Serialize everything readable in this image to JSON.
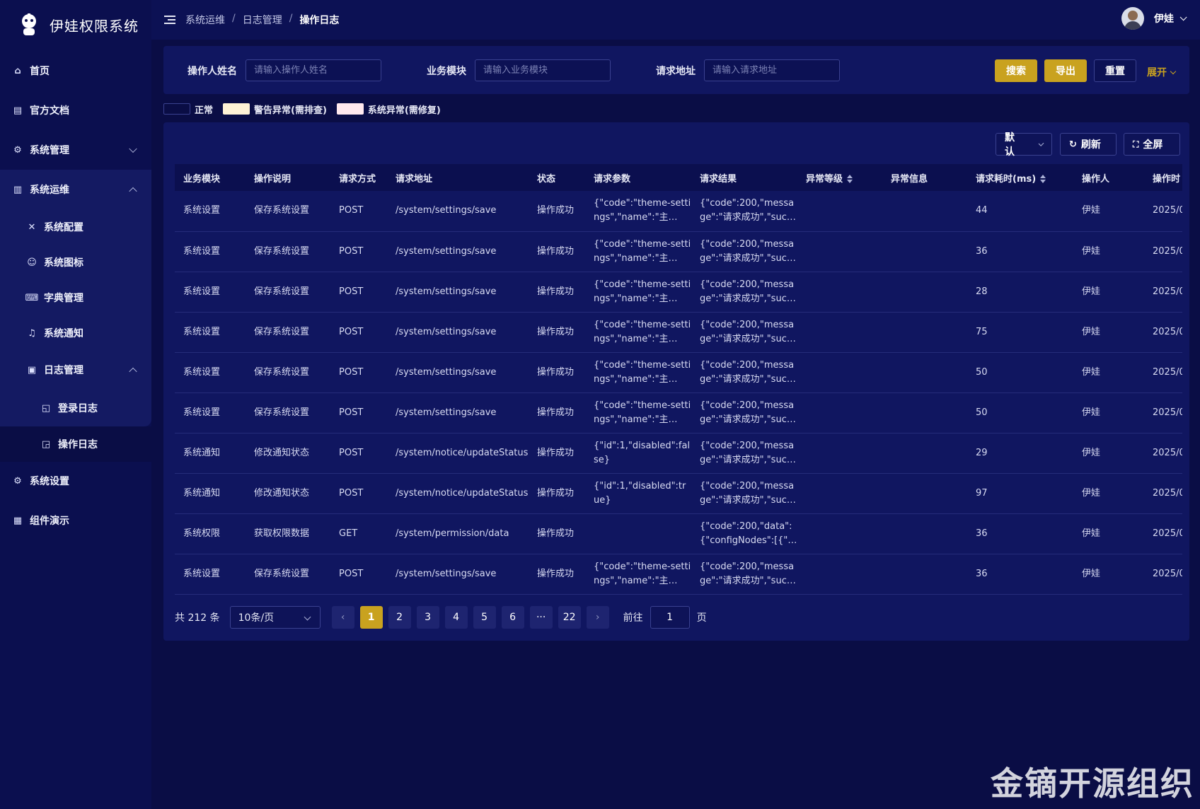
{
  "app": {
    "title": "伊娃权限系统"
  },
  "sidebar": {
    "items": [
      {
        "label": "首页",
        "icon": "home-icon"
      },
      {
        "label": "官方文档",
        "icon": "doc-icon"
      },
      {
        "label": "系统管理",
        "icon": "gear-icon"
      },
      {
        "label": "系统运维",
        "icon": "bar-chart-icon"
      },
      {
        "label": "系统配置",
        "icon": "tools-icon"
      },
      {
        "label": "系统图标",
        "icon": "smile-icon"
      },
      {
        "label": "字典管理",
        "icon": "keyboard-icon"
      },
      {
        "label": "系统通知",
        "icon": "bell-icon"
      },
      {
        "label": "日志管理",
        "icon": "clipboard-icon"
      },
      {
        "label": "登录日志",
        "icon": "login-log-icon"
      },
      {
        "label": "操作日志",
        "icon": "operation-log-icon"
      },
      {
        "label": "系统设置",
        "icon": "gear-icon"
      },
      {
        "label": "组件演示",
        "icon": "component-icon"
      }
    ]
  },
  "header": {
    "breadcrumb": [
      "系统运维",
      "日志管理",
      "操作日志"
    ],
    "separator": "/",
    "user": "伊娃"
  },
  "filter": {
    "operator_label": "操作人姓名",
    "operator_placeholder": "请输入操作人姓名",
    "module_label": "业务模块",
    "module_placeholder": "请输入业务模块",
    "url_label": "请求地址",
    "url_placeholder": "请输入请求地址",
    "search": "搜索",
    "export": "导出",
    "reset": "重置",
    "expand": "展开"
  },
  "legend": {
    "items": [
      {
        "label": "正常",
        "color": "#0a0d45"
      },
      {
        "label": "警告异常(需排查)",
        "color": "#fff3d6"
      },
      {
        "label": "系统异常(需修复)",
        "color": "#ffe9ee"
      }
    ]
  },
  "toolbar": {
    "size": "默认",
    "refresh": "刷新",
    "fullscreen": "全屏"
  },
  "table": {
    "columns": [
      "业务模块",
      "操作说明",
      "请求方式",
      "请求地址",
      "状态",
      "请求参数",
      "请求结果",
      "异常等级",
      "异常信息",
      "请求耗时(ms)",
      "操作人",
      "操作时"
    ],
    "rows": [
      [
        "系统设置",
        "保存系统设置",
        "POST",
        "/system/settings/save",
        "操作成功",
        "{\"code\":\"theme-settings\",\"name\":\"主…",
        "{\"code\":200,\"message\":\"请求成功\",\"suc…",
        "",
        "",
        "44",
        "伊娃",
        "2025/0"
      ],
      [
        "系统设置",
        "保存系统设置",
        "POST",
        "/system/settings/save",
        "操作成功",
        "{\"code\":\"theme-settings\",\"name\":\"主…",
        "{\"code\":200,\"message\":\"请求成功\",\"suc…",
        "",
        "",
        "36",
        "伊娃",
        "2025/0"
      ],
      [
        "系统设置",
        "保存系统设置",
        "POST",
        "/system/settings/save",
        "操作成功",
        "{\"code\":\"theme-settings\",\"name\":\"主…",
        "{\"code\":200,\"message\":\"请求成功\",\"suc…",
        "",
        "",
        "28",
        "伊娃",
        "2025/0"
      ],
      [
        "系统设置",
        "保存系统设置",
        "POST",
        "/system/settings/save",
        "操作成功",
        "{\"code\":\"theme-settings\",\"name\":\"主…",
        "{\"code\":200,\"message\":\"请求成功\",\"suc…",
        "",
        "",
        "75",
        "伊娃",
        "2025/0"
      ],
      [
        "系统设置",
        "保存系统设置",
        "POST",
        "/system/settings/save",
        "操作成功",
        "{\"code\":\"theme-settings\",\"name\":\"主…",
        "{\"code\":200,\"message\":\"请求成功\",\"suc…",
        "",
        "",
        "50",
        "伊娃",
        "2025/0"
      ],
      [
        "系统设置",
        "保存系统设置",
        "POST",
        "/system/settings/save",
        "操作成功",
        "{\"code\":\"theme-settings\",\"name\":\"主…",
        "{\"code\":200,\"message\":\"请求成功\",\"suc…",
        "",
        "",
        "50",
        "伊娃",
        "2025/0"
      ],
      [
        "系统通知",
        "修改通知状态",
        "POST",
        "/system/notice/updateStatus",
        "操作成功",
        "{\"id\":1,\"disabled\":false}",
        "{\"code\":200,\"message\":\"请求成功\",\"suc…",
        "",
        "",
        "29",
        "伊娃",
        "2025/0"
      ],
      [
        "系统通知",
        "修改通知状态",
        "POST",
        "/system/notice/updateStatus",
        "操作成功",
        "{\"id\":1,\"disabled\":true}",
        "{\"code\":200,\"message\":\"请求成功\",\"suc…",
        "",
        "",
        "97",
        "伊娃",
        "2025/0"
      ],
      [
        "系统权限",
        "获取权限数据",
        "GET",
        "/system/permission/data",
        "操作成功",
        "",
        "{\"code\":200,\"data\":{\"configNodes\":[{\"…",
        "",
        "",
        "36",
        "伊娃",
        "2025/0"
      ],
      [
        "系统设置",
        "保存系统设置",
        "POST",
        "/system/settings/save",
        "操作成功",
        "{\"code\":\"theme-settings\",\"name\":\"主…",
        "{\"code\":200,\"message\":\"请求成功\",\"suc…",
        "",
        "",
        "36",
        "伊娃",
        "2025/0"
      ]
    ]
  },
  "pagination": {
    "total_text": "共 212 条",
    "page_size": "10条/页",
    "pages": [
      "1",
      "2",
      "3",
      "4",
      "5",
      "6",
      "···",
      "22"
    ],
    "current": "1",
    "goto_prefix": "前往",
    "goto_value": "1",
    "goto_suffix": "页"
  },
  "watermark": "金镝开源组织"
}
